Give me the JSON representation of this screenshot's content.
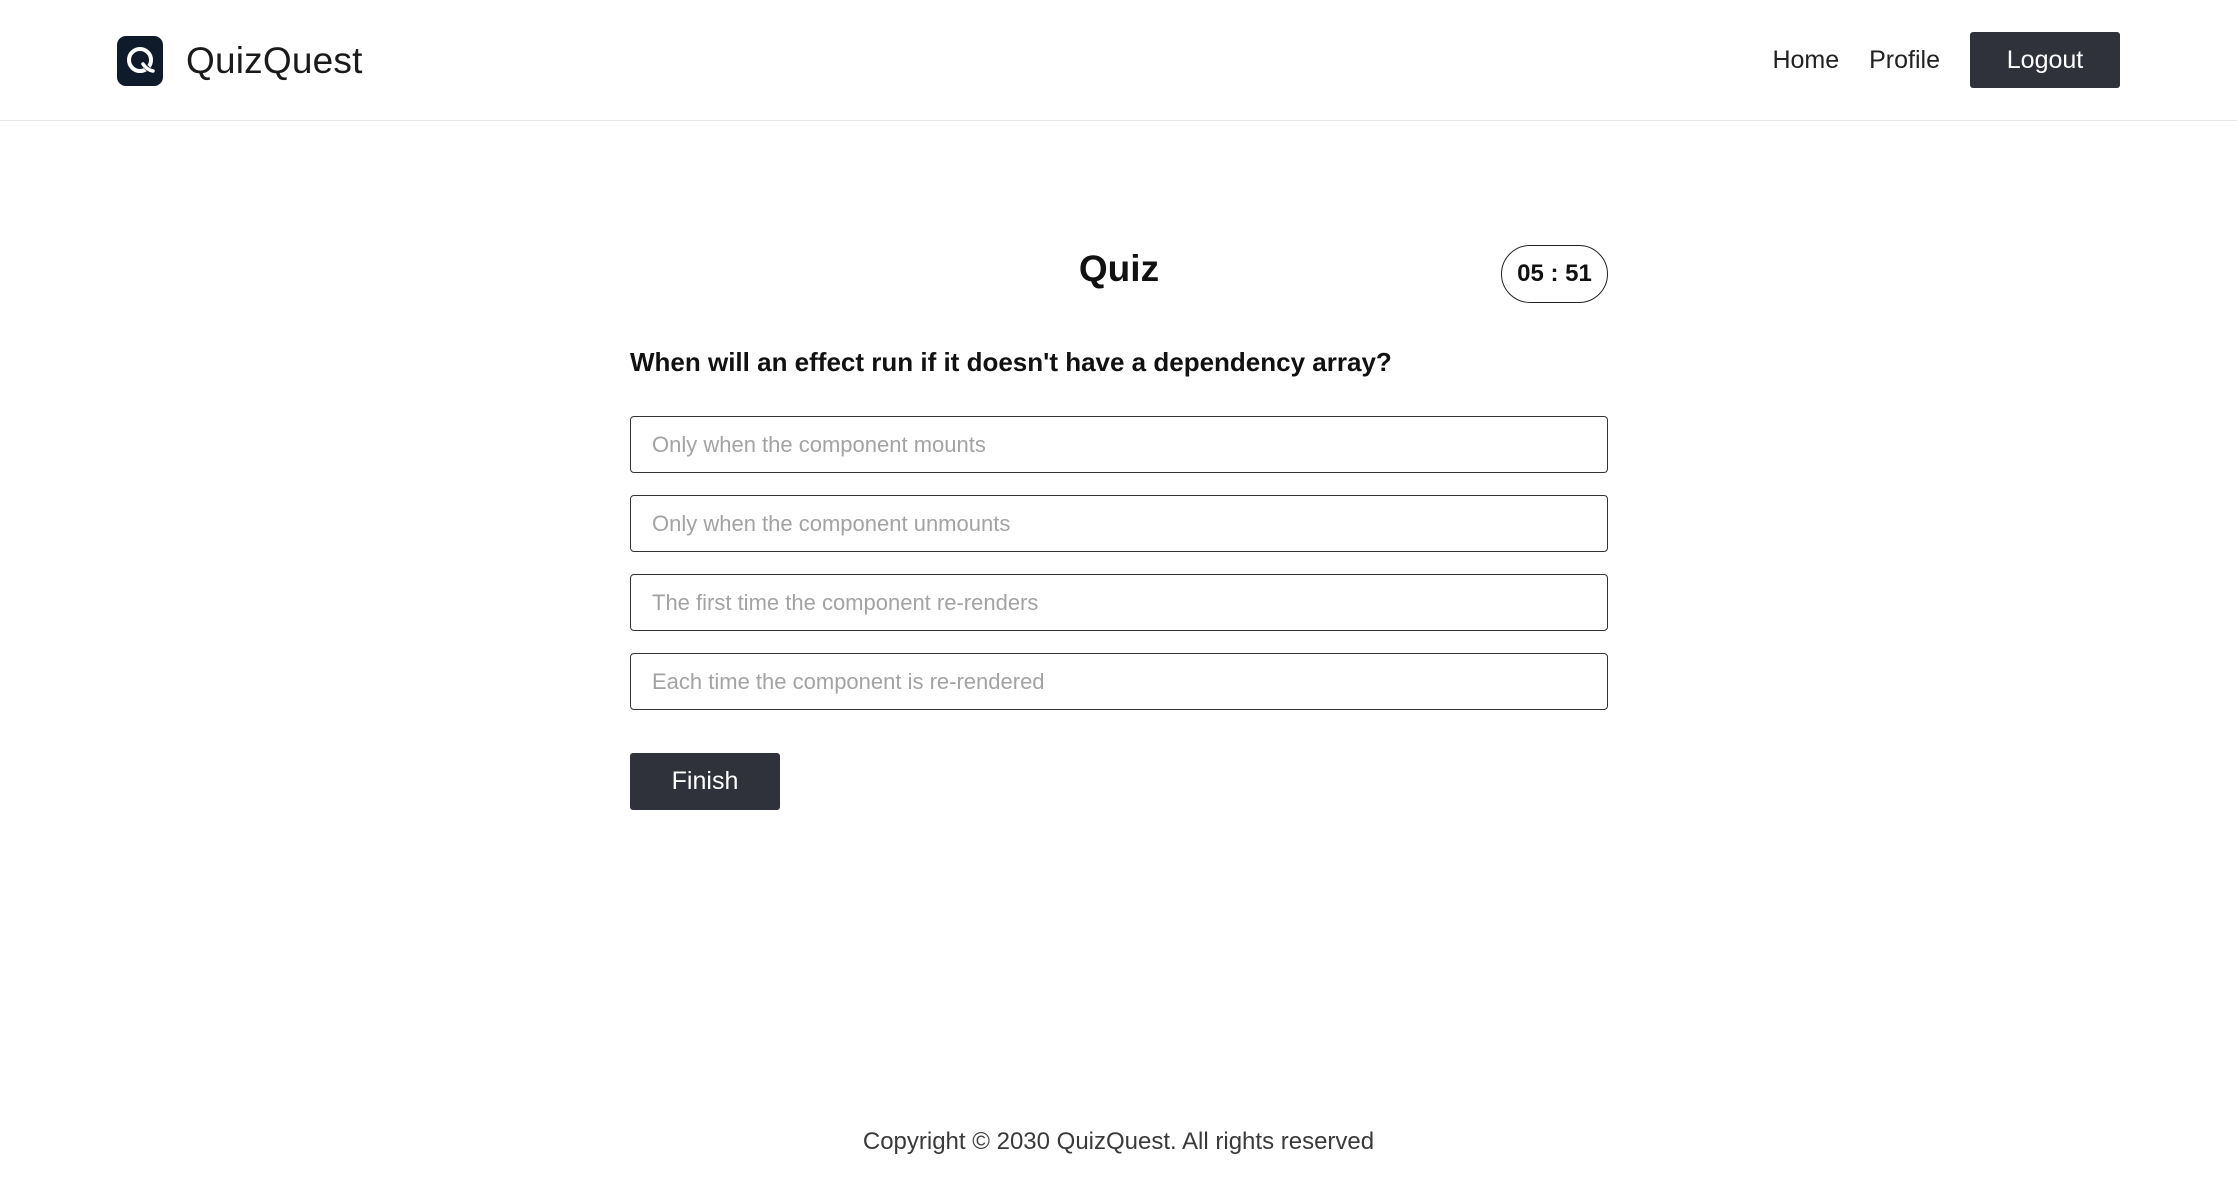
{
  "navbar": {
    "brand_name": "QuizQuest",
    "logo_icon": "quiz-q-logo-icon",
    "links": [
      {
        "label": "Home"
      },
      {
        "label": "Profile"
      }
    ],
    "logout_label": "Logout"
  },
  "quiz": {
    "title": "Quiz",
    "timer": "05 : 51",
    "question": "When will an effect run if it doesn't have a dependency array?",
    "options": [
      {
        "text": "Only when the component mounts"
      },
      {
        "text": "Only when the component unmounts"
      },
      {
        "text": "The first time the component re-renders"
      },
      {
        "text": "Each time the component is re-rendered"
      }
    ],
    "finish_label": "Finish"
  },
  "footer": {
    "copyright": "Copyright © 2030 QuizQuest. All rights reserved"
  },
  "colors": {
    "primary_button": "#2f323a",
    "logo_bg": "#0f1b2a",
    "option_text": "#a3a3a3"
  }
}
